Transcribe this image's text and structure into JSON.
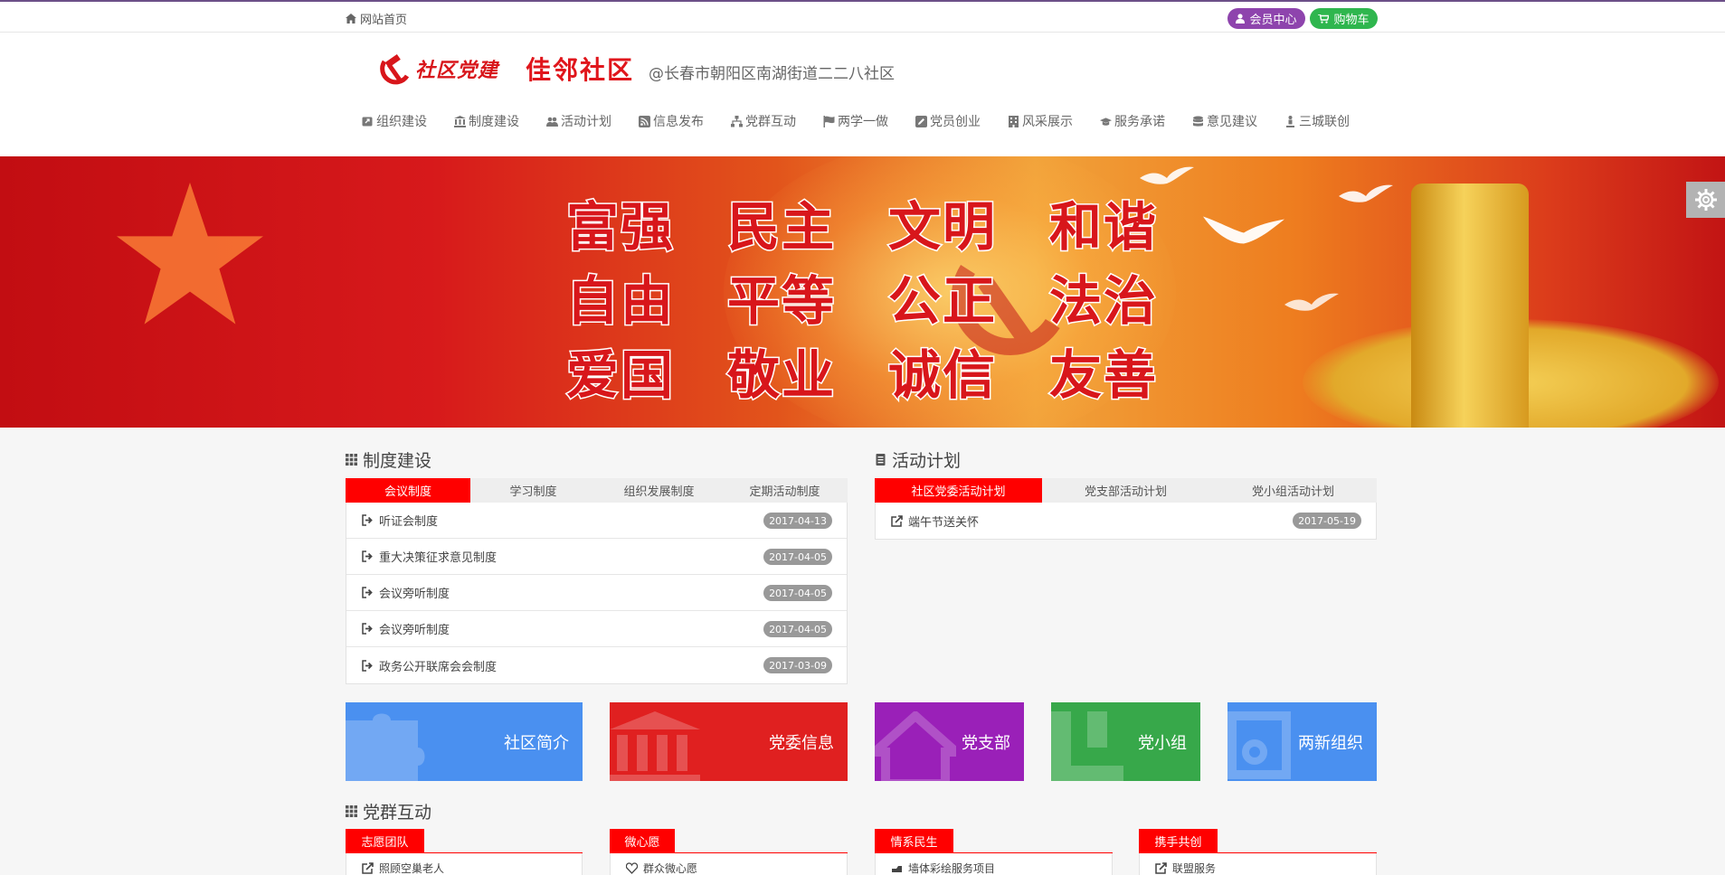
{
  "topbar": {
    "home_label": "网站首页",
    "member_label": "会员中心",
    "cart_label": "购物车"
  },
  "header": {
    "logo_party": "社区党建",
    "logo_name": "佳邻社区",
    "logo_location": "@长春市朝阳区南湖街道二二八社区"
  },
  "nav": {
    "items": [
      {
        "label": "组织建设",
        "icon": "share-icon"
      },
      {
        "label": "制度建设",
        "icon": "institution-icon"
      },
      {
        "label": "活动计划",
        "icon": "users-icon"
      },
      {
        "label": "信息发布",
        "icon": "rss-icon"
      },
      {
        "label": "党群互动",
        "icon": "sitemap-icon"
      },
      {
        "label": "两学一做",
        "icon": "flag-icon"
      },
      {
        "label": "党员创业",
        "icon": "edit-icon"
      },
      {
        "label": "风采展示",
        "icon": "building-icon"
      },
      {
        "label": "服务承诺",
        "icon": "graduation-cap-icon"
      },
      {
        "label": "意见建议",
        "icon": "database-icon"
      },
      {
        "label": "三城联创",
        "icon": "person-icon"
      }
    ]
  },
  "banner": {
    "slogans": [
      "富强",
      "民主",
      "文明",
      "和谐",
      "自由",
      "平等",
      "公正",
      "法治",
      "爱国",
      "敬业",
      "诚信",
      "友善"
    ]
  },
  "system": {
    "title": "制度建设",
    "tabs": [
      "会议制度",
      "学习制度",
      "组织发展制度",
      "定期活动制度"
    ],
    "items": [
      {
        "text": "听证会制度",
        "date": "2017-04-13"
      },
      {
        "text": "重大决策征求意见制度",
        "date": "2017-04-05"
      },
      {
        "text": "会议旁听制度",
        "date": "2017-04-05"
      },
      {
        "text": "会议旁听制度",
        "date": "2017-04-05"
      },
      {
        "text": "政务公开联席会会制度",
        "date": "2017-03-09"
      }
    ]
  },
  "activity": {
    "title": "活动计划",
    "tabs": [
      "社区党委活动计划",
      "党支部活动计划",
      "党小组活动计划"
    ],
    "items": [
      {
        "text": "端午节送关怀",
        "date": "2017-05-19"
      }
    ]
  },
  "tiles": [
    {
      "label": "社区简介",
      "color": "#4a90f0",
      "icon": "puzzle-icon"
    },
    {
      "label": "党委信息",
      "color": "#e02020",
      "icon": "institution-icon"
    },
    {
      "label": "党支部",
      "color": "#9a20b8",
      "icon": "home-icon"
    },
    {
      "label": "党小组",
      "color": "#37a84a",
      "icon": "grid-icon"
    },
    {
      "label": "两新组织",
      "color": "#4a90f0",
      "icon": "cup-icon"
    }
  ],
  "interaction": {
    "title": "党群互动",
    "groups": [
      {
        "tab": "志愿团队",
        "item": "照顾空巢老人"
      },
      {
        "tab": "微心愿",
        "item": "群众微心愿"
      },
      {
        "tab": "情系民生",
        "item": "墙体彩绘服务项目"
      },
      {
        "tab": "携手共创",
        "item": "联盟服务"
      }
    ]
  },
  "colors": {
    "accent_red": "#ff0000",
    "member_purple": "#8e44ad",
    "cart_green": "#2fb64e",
    "date_badge": "#999999"
  }
}
